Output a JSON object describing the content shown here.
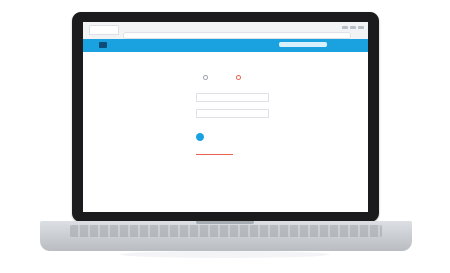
{
  "browser": {
    "tab_label": "",
    "address": ""
  },
  "app": {
    "brand_name": "",
    "brand_color": "#1aa2e0",
    "accent_color": "#e6624f"
  },
  "form": {
    "title": "",
    "radio_options": [
      {
        "label": "",
        "selected": false
      },
      {
        "label": "",
        "selected": true
      }
    ],
    "note": "",
    "fields": [
      {
        "label": "",
        "value": ""
      },
      {
        "label": "",
        "value": ""
      }
    ],
    "cta_label": "",
    "tabs": [
      {
        "label": "",
        "active": true
      },
      {
        "label": "",
        "active": false
      }
    ],
    "summary_label": "",
    "total": "",
    "fine_print": [
      "",
      "",
      ""
    ],
    "back_link": "",
    "primary_button": "",
    "secondary_button": ""
  }
}
